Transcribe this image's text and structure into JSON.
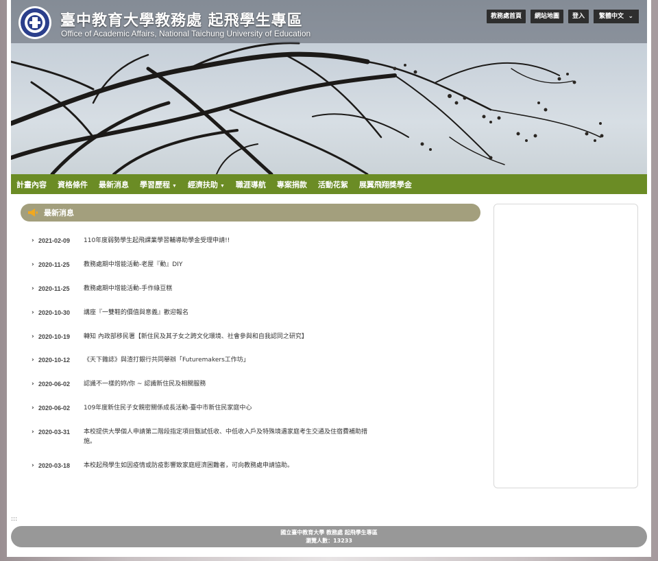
{
  "header": {
    "title": "臺中教育大學教務處 起飛學生專區",
    "subtitle": "Office of Academic Affairs, National Taichung University of Education",
    "links": [
      "教務處首頁",
      "網站地圖",
      "登入"
    ],
    "language": "繁體中文"
  },
  "nav": {
    "items": [
      {
        "label": "計畫內容"
      },
      {
        "label": "資格條件"
      },
      {
        "label": "最新消息"
      },
      {
        "label": "學習歷程"
      },
      {
        "label": "經濟扶助"
      },
      {
        "label": "職涯導航"
      },
      {
        "label": "專案捐款"
      },
      {
        "label": "活動花絮"
      },
      {
        "label": "展翼飛翔獎學金"
      }
    ]
  },
  "news": {
    "heading": "最新消息",
    "items": [
      {
        "date": "2021-02-09",
        "title": "110年度弱勢學生起飛課業學習輔導助學金受理申請!!"
      },
      {
        "date": "2020-11-25",
        "title": "教務處期中增能活動-老屋『動』DIY"
      },
      {
        "date": "2020-11-25",
        "title": "教務處期中增能活動-手作綠豆糕"
      },
      {
        "date": "2020-10-30",
        "title": "講座『一雙鞋的價值與意義』歡迎報名"
      },
      {
        "date": "2020-10-19",
        "title": "轉知 內政部移民署【新住民及其子女之跨文化環境、社會參與和自我認同之研究】"
      },
      {
        "date": "2020-10-12",
        "title": "《天下雜誌》與渣打銀行共同舉辦「Futuremakers工作坊」"
      },
      {
        "date": "2020-06-02",
        "title": "認識不一樣的妳/你 ~ 認識新住民及相關服務"
      },
      {
        "date": "2020-06-02",
        "title": "109年度新住民子女親密關係成長活動-臺中市新住民家庭中心"
      },
      {
        "date": "2020-03-31",
        "title": "本校提供大學個人申請第二階段指定項目甄試低收、中低收入戶及特殊境遇家庭考生交通及住宿費補助措施。"
      },
      {
        "date": "2020-03-18",
        "title": "本校起飛學生如因疫情或防疫影響致家庭經濟困難者，可向教務處申請協助。"
      }
    ]
  },
  "accesskey": ":::",
  "footer": {
    "line1": "國立臺中教育大學 教務處 起飛學生專區",
    "line2": "瀏覽人數：13233"
  },
  "colors": {
    "nav_bg": "#6b8c25",
    "news_header_bg": "#a39f7d",
    "footer_bg": "#989898"
  }
}
